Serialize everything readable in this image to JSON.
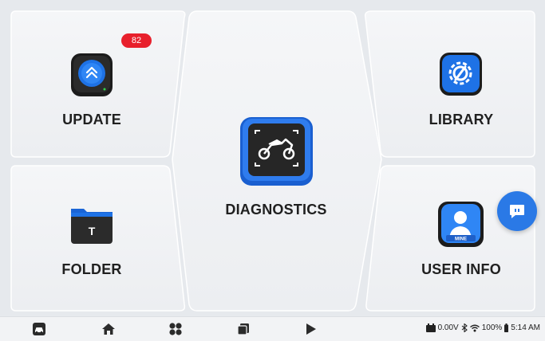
{
  "tiles": {
    "update_label": "UPDATE",
    "update_badge": "82",
    "folder_label": "FOLDER",
    "diagnostics_label": "DIAGNOSTICS",
    "library_label": "LIBRARY",
    "user_info_label": "USER INFO",
    "user_icon_caption": "MINE",
    "folder_icon_letter": "T"
  },
  "status_bar": {
    "voltage": "0.00V",
    "battery": "100%",
    "time": "5:14 AM"
  },
  "nav": {
    "icons": [
      "diagnostic-car-icon",
      "home-icon",
      "apps-icon",
      "recents-icon",
      "play-icon"
    ]
  },
  "colors": {
    "accent": "#1e6fe0",
    "badge": "#e8202c",
    "background": "#e6e9ed",
    "tile": "#f2f3f5"
  }
}
